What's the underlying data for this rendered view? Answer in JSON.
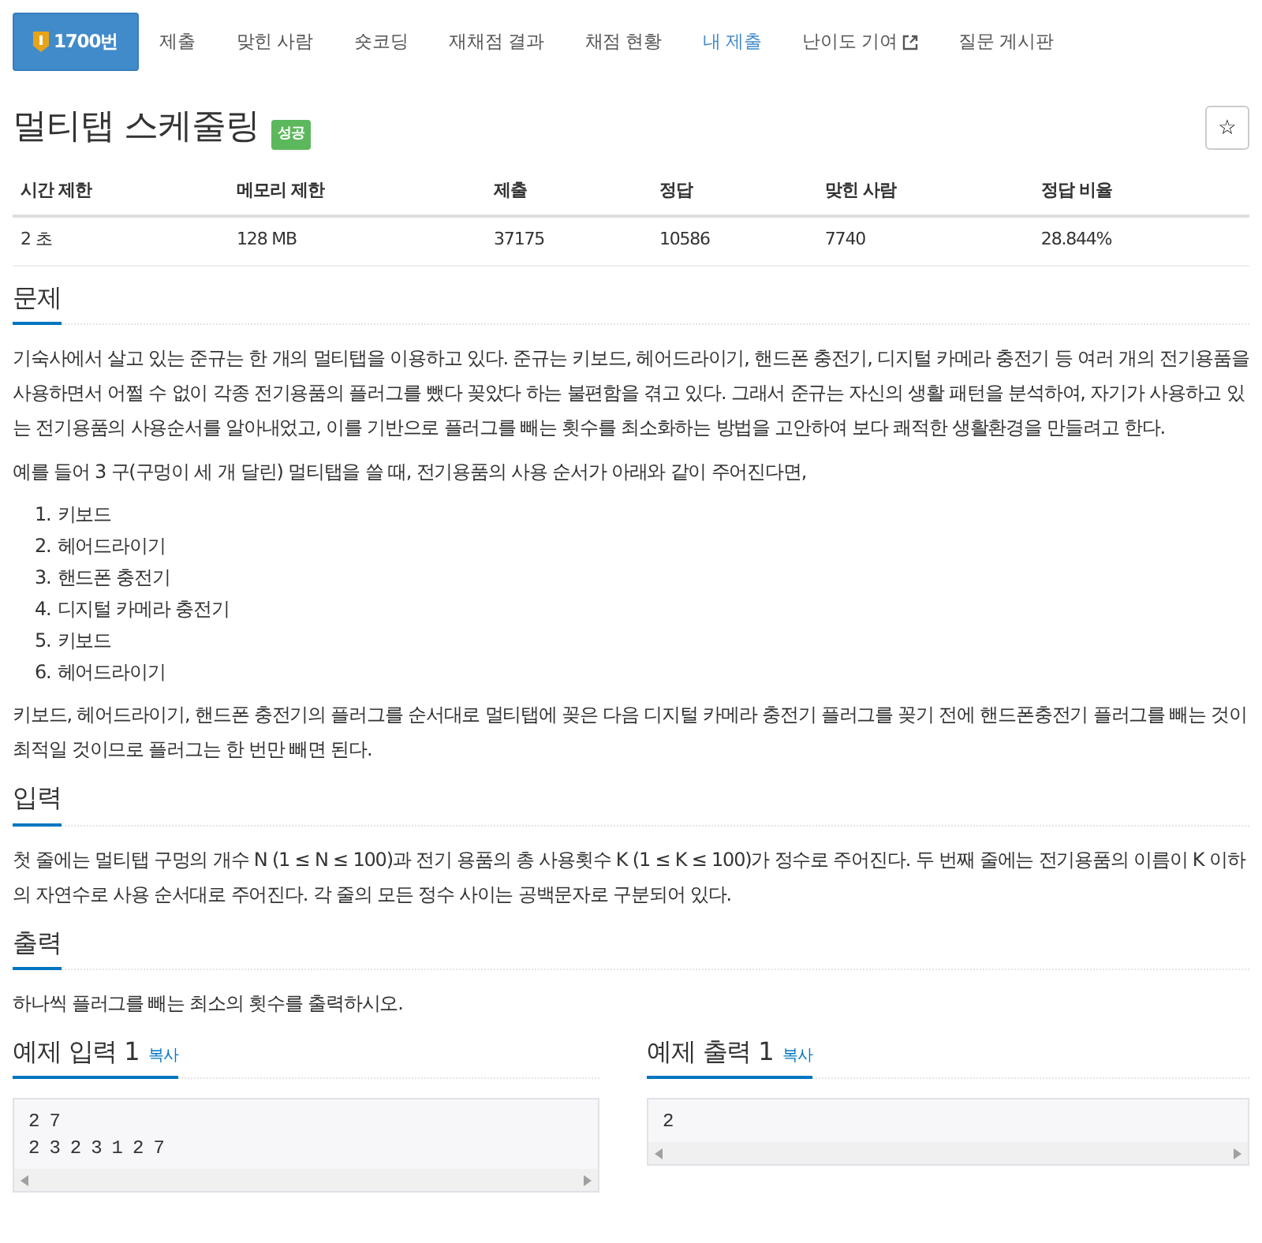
{
  "tabs": [
    {
      "label": "1700번",
      "selected": true,
      "kind": "problem"
    },
    {
      "label": "제출",
      "selected": false,
      "kind": "plain"
    },
    {
      "label": "맞힌 사람",
      "selected": false,
      "kind": "plain"
    },
    {
      "label": "숏코딩",
      "selected": false,
      "kind": "plain"
    },
    {
      "label": "재채점 결과",
      "selected": false,
      "kind": "plain"
    },
    {
      "label": "채점 현황",
      "selected": false,
      "kind": "plain"
    },
    {
      "label": "내 제출",
      "selected": false,
      "kind": "mine"
    },
    {
      "label": "난이도 기여",
      "selected": false,
      "kind": "external"
    },
    {
      "label": "질문 게시판",
      "selected": false,
      "kind": "plain"
    }
  ],
  "problem": {
    "title": "멀티탭 스케줄링",
    "badge": "성공",
    "star": "☆"
  },
  "info_table": {
    "columns": [
      "시간 제한",
      "메모리 제한",
      "제출",
      "정답",
      "맞힌 사람",
      "정답 비율"
    ],
    "rows": [
      [
        "2 초",
        "128 MB",
        "37175",
        "10586",
        "7740",
        "28.844%"
      ]
    ]
  },
  "sections": [
    {
      "heading": "문제",
      "blocks": [
        {
          "kind": "paragraph",
          "text": "기숙사에서 살고 있는 준규는 한 개의 멀티탭을 이용하고 있다. 준규는 키보드, 헤어드라이기, 핸드폰 충전기, 디지털 카메라 충전기 등 여러 개의 전기용품을 사용하면서 어쩔 수 없이 각종 전기용품의 플러그를 뺐다 꽂았다 하는 불편함을 겪고 있다. 그래서 준규는 자신의 생활 패턴을 분석하여, 자기가 사용하고 있는 전기용품의 사용순서를 알아내었고, 이를 기반으로 플러그를 빼는 횟수를 최소화하는 방법을 고안하여 보다 쾌적한 생활환경을 만들려고 한다."
        },
        {
          "kind": "paragraph",
          "text": "예를 들어 3 구(구멍이 세 개 달린) 멀티탭을 쓸 때, 전기용품의 사용 순서가 아래와 같이 주어진다면,"
        },
        {
          "kind": "list",
          "items": [
            {
              "number": "1.",
              "text": "키보드"
            },
            {
              "number": "2.",
              "text": "헤어드라이기"
            },
            {
              "number": "3.",
              "text": "핸드폰 충전기"
            },
            {
              "number": "4.",
              "text": "디지털 카메라 충전기"
            },
            {
              "number": "5.",
              "text": "키보드"
            },
            {
              "number": "6.",
              "text": "헤어드라이기"
            }
          ]
        },
        {
          "kind": "paragraph",
          "text": "키보드, 헤어드라이기, 핸드폰 충전기의 플러그를 순서대로 멀티탭에 꽂은 다음 디지털 카메라 충전기 플러그를 꽂기 전에 핸드폰충전기 플러그를 빼는 것이 최적일 것이므로 플러그는 한 번만 빼면 된다."
        }
      ]
    },
    {
      "heading": "입력",
      "blocks": [
        {
          "kind": "paragraph",
          "text": "첫 줄에는 멀티탭 구멍의 개수 N (1 ≤ N ≤ 100)과 전기 용품의 총 사용횟수 K (1 ≤ K ≤ 100)가 정수로 주어진다. 두 번째 줄에는 전기용품의 이름이 K 이하의 자연수로 사용 순서대로 주어진다. 각 줄의 모든 정수 사이는 공백문자로 구분되어 있다."
        }
      ]
    },
    {
      "heading": "출력",
      "blocks": [
        {
          "kind": "paragraph",
          "text": "하나씩 플러그를 빼는 최소의 횟수를 출력하시오."
        }
      ]
    }
  ],
  "samples": [
    {
      "heading": "예제 입력 1",
      "copy": "복사",
      "lines": [
        "2 7",
        "2 3 2 3 1 2 7"
      ]
    },
    {
      "heading": "예제 출력 1",
      "copy": "복사",
      "lines": [
        "2"
      ]
    }
  ]
}
